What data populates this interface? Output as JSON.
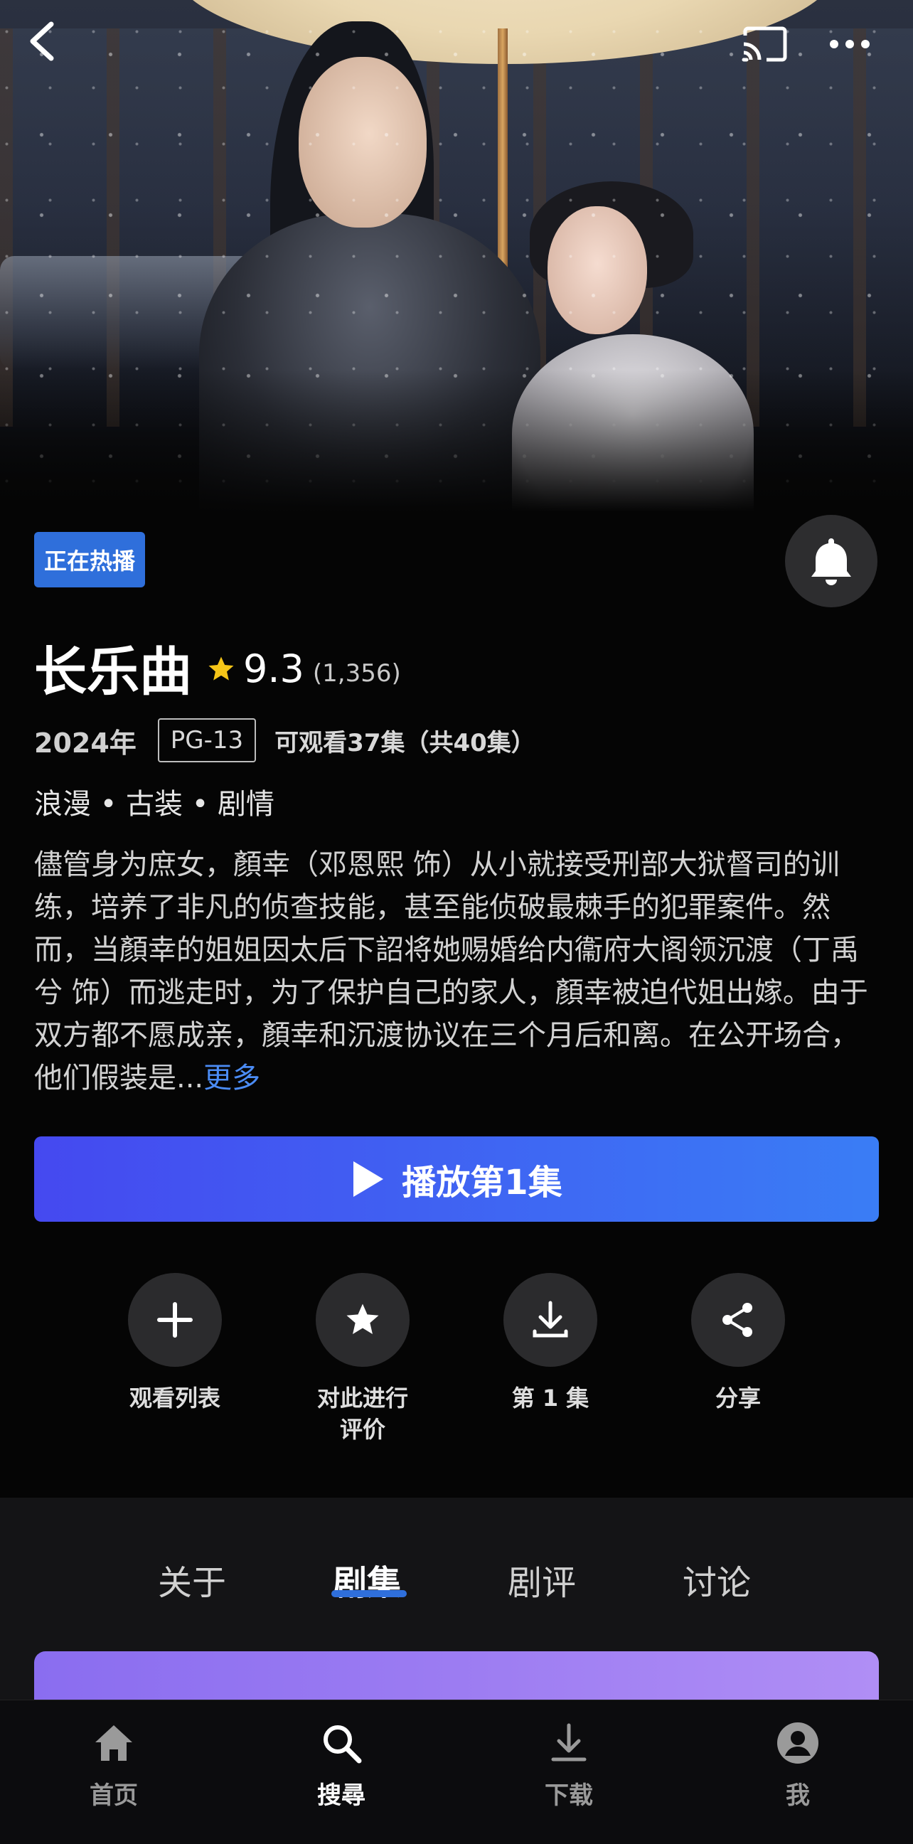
{
  "header": {
    "back_icon": "chevron-left-icon",
    "cast_icon": "cast-icon",
    "more_icon": "more-horizontal-icon"
  },
  "show": {
    "badge": "正在热播",
    "title": "长乐曲",
    "rating": "9.3",
    "votes": "(1,356)",
    "year": "2024年",
    "content_rating": "PG-13",
    "episodes_available": "可观看37集（共40集）",
    "genres": "浪漫 • 古装 • 剧情",
    "description": "儘管身为庶女，顏幸（邓恩熙 饰）从小就接受刑部大狱督司的训练，培养了非凡的侦查技能，甚至能侦破最棘手的犯罪案件。然而，当顏幸的姐姐因太后下詔将她赐婚给内衞府大阁领沉渡（丁禹兮 饰）而逃走时，为了保护自己的家人，顏幸被迫代姐出嫁。由于双方都不愿成亲，顏幸和沉渡协议在三个月后和离。在公开场合，他们假装是...",
    "more_label": "更多",
    "bell_icon": "bell-icon"
  },
  "play": {
    "label": "播放第1集",
    "icon": "play-icon"
  },
  "actions": [
    {
      "label": "观看列表",
      "icon": "plus-icon"
    },
    {
      "label": "对此进行\n评价",
      "icon": "star-icon"
    },
    {
      "label": "第 1 集",
      "icon": "download-icon"
    },
    {
      "label": "分享",
      "icon": "share-icon"
    }
  ],
  "tabs": [
    {
      "label": "关于",
      "active": false
    },
    {
      "label": "剧集",
      "active": true
    },
    {
      "label": "剧评",
      "active": false
    },
    {
      "label": "讨论",
      "active": false
    }
  ],
  "bottom_nav": [
    {
      "label": "首页",
      "icon": "home-icon",
      "active": false
    },
    {
      "label": "搜尋",
      "icon": "search-icon",
      "active": true
    },
    {
      "label": "下载",
      "icon": "download-icon",
      "active": false
    },
    {
      "label": "我",
      "icon": "profile-icon",
      "active": false
    }
  ],
  "colors": {
    "accent_blue": "#2f6fdb",
    "play_gradient_start": "#4549f0",
    "play_gradient_end": "#3a7df5",
    "star_yellow": "#f5c518",
    "link_blue": "#4b8cf5"
  }
}
